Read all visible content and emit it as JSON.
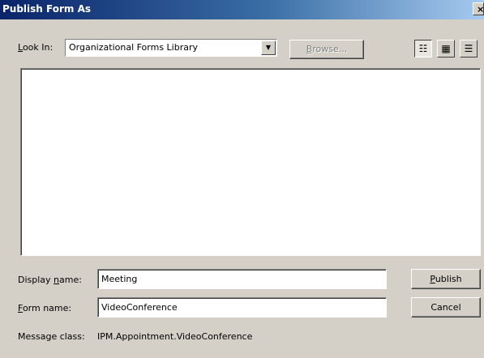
{
  "window": {
    "title": "Publish Form As",
    "close_glyph": "×"
  },
  "look_in": {
    "label_accel": "L",
    "label_rest": "ook In:",
    "value": "Organizational Forms Library",
    "dropdown_glyph": "▼"
  },
  "browse": {
    "label_accel": "B",
    "label_rest": "rowse..."
  },
  "view_buttons": [
    {
      "icon": "list-view-icon",
      "glyph": "☷"
    },
    {
      "icon": "details-view-icon",
      "glyph": "▦"
    },
    {
      "icon": "properties-view-icon",
      "glyph": "☰"
    }
  ],
  "display_name": {
    "label_pre": "Display ",
    "label_accel": "n",
    "label_post": "ame:",
    "value": "Meeting"
  },
  "form_name": {
    "label_accel": "F",
    "label_rest": "orm name:",
    "value": "VideoConference"
  },
  "publish": {
    "label_accel": "P",
    "label_rest": "ublish"
  },
  "cancel": {
    "label": "Cancel"
  },
  "message_class": {
    "label": "Message class:",
    "value": "IPM.Appointment.VideoConference"
  }
}
